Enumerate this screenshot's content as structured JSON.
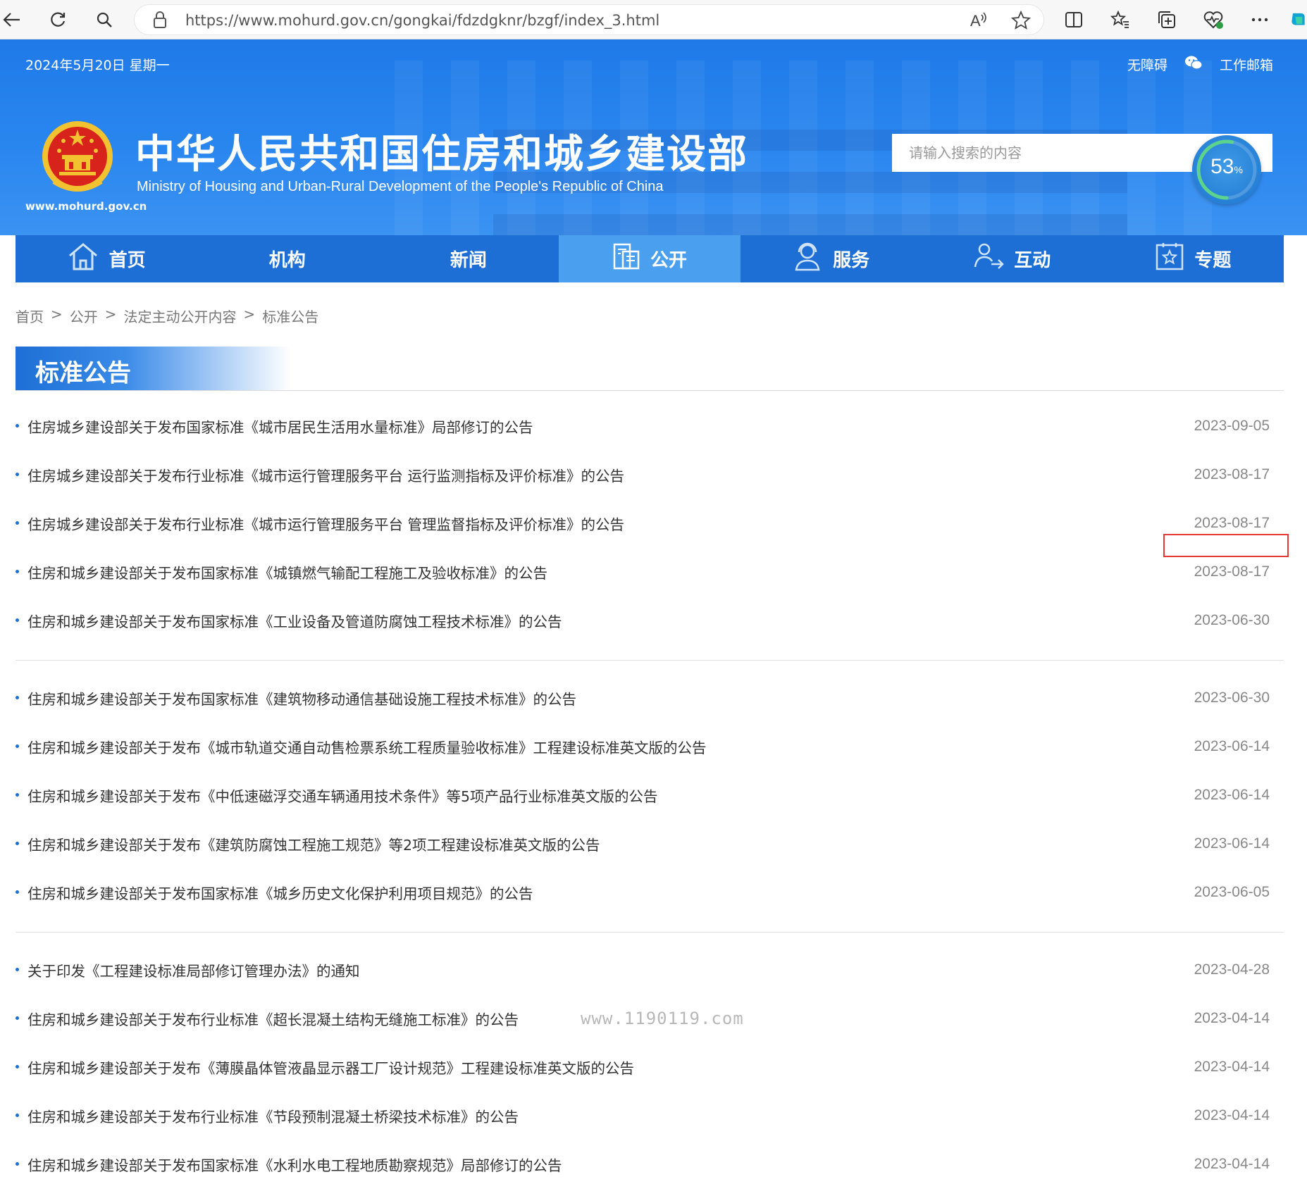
{
  "browser": {
    "url": "https://www.mohurd.gov.cn/gongkai/fdzdgknr/bzgf/index_3.html"
  },
  "header": {
    "date": "2024年5月20日 星期一",
    "accessibility": "无障碍",
    "mail": "工作邮箱",
    "title_cn": "中华人民共和国住房和城乡建设部",
    "title_en": "Ministry of Housing and Urban-Rural Development of the People's Republic of China",
    "site_url": "www.mohurd.gov.cn",
    "search_placeholder": "请输入搜索的内容",
    "progress_value": "53",
    "progress_unit": "%",
    "progress_fraction": 0.53
  },
  "nav": [
    {
      "label": "首页",
      "icon": "home-icon"
    },
    {
      "label": "机构",
      "icon": ""
    },
    {
      "label": "新闻",
      "icon": ""
    },
    {
      "label": "公开",
      "icon": "document-icon"
    },
    {
      "label": "服务",
      "icon": "service-icon"
    },
    {
      "label": "互动",
      "icon": "interact-icon"
    },
    {
      "label": "专题",
      "icon": "topic-icon"
    }
  ],
  "breadcrumb": [
    "首页",
    "公开",
    "法定主动公开内容",
    "标准公告"
  ],
  "breadcrumb_sep": ">",
  "section_title": "标准公告",
  "groups": [
    [
      {
        "title": "住房城乡建设部关于发布国家标准《城市居民生活用水量标准》局部修订的公告",
        "date": "2023-09-05"
      },
      {
        "title": "住房城乡建设部关于发布行业标准《城市运行管理服务平台 运行监测指标及评价标准》的公告",
        "date": "2023-08-17"
      },
      {
        "title": "住房城乡建设部关于发布行业标准《城市运行管理服务平台 管理监督指标及评价标准》的公告",
        "date": "2023-08-17"
      },
      {
        "title": "住房和城乡建设部关于发布国家标准《城镇燃气输配工程施工及验收标准》的公告",
        "date": "2023-08-17"
      },
      {
        "title": "住房和城乡建设部关于发布国家标准《工业设备及管道防腐蚀工程技术标准》的公告",
        "date": "2023-06-30"
      }
    ],
    [
      {
        "title": "住房和城乡建设部关于发布国家标准《建筑物移动通信基础设施工程技术标准》的公告",
        "date": "2023-06-30"
      },
      {
        "title": "住房和城乡建设部关于发布《城市轨道交通自动售检票系统工程质量验收标准》工程建设标准英文版的公告",
        "date": "2023-06-14"
      },
      {
        "title": "住房和城乡建设部关于发布《中低速磁浮交通车辆通用技术条件》等5项产品行业标准英文版的公告",
        "date": "2023-06-14"
      },
      {
        "title": "住房和城乡建设部关于发布《建筑防腐蚀工程施工规范》等2项工程建设标准英文版的公告",
        "date": "2023-06-14"
      },
      {
        "title": "住房和城乡建设部关于发布国家标准《城乡历史文化保护利用项目规范》的公告",
        "date": "2023-06-05"
      }
    ],
    [
      {
        "title": "关于印发《工程建设标准局部修订管理办法》的通知",
        "date": "2023-04-28"
      },
      {
        "title": "住房和城乡建设部关于发布行业标准《超长混凝土结构无缝施工标准》的公告",
        "date": "2023-04-14"
      },
      {
        "title": "住房和城乡建设部关于发布《薄膜晶体管液晶显示器工厂设计规范》工程建设标准英文版的公告",
        "date": "2023-04-14"
      },
      {
        "title": "住房和城乡建设部关于发布行业标准《节段预制混凝土桥梁技术标准》的公告",
        "date": "2023-04-14"
      },
      {
        "title": "住房和城乡建设部关于发布国家标准《水利水电工程地质勘察规范》局部修订的公告",
        "date": "2023-04-14"
      }
    ]
  ],
  "watermark": "www.1190119.com",
  "colors": {
    "primary": "#1d6fd6",
    "nav_active": "#4aa0ee",
    "annotation": "#e53935"
  }
}
